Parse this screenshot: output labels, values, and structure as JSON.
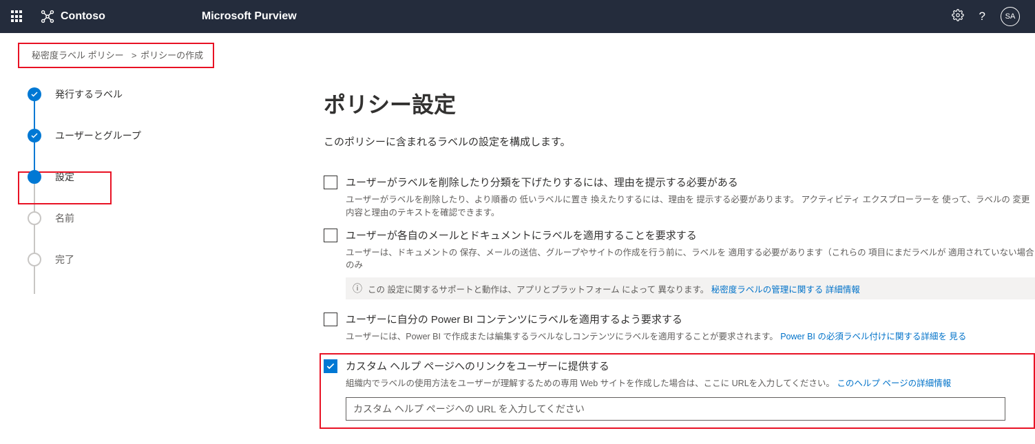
{
  "header": {
    "org": "Contoso",
    "product": "Microsoft Purview",
    "avatar": "SA"
  },
  "breadcrumb": {
    "parent": "秘密度ラベル ポリシー",
    "current": "ポリシーの作成"
  },
  "steps": [
    {
      "label": "発行するラベル"
    },
    {
      "label": "ユーザーとグループ"
    },
    {
      "label": "設定"
    },
    {
      "label": "名前"
    },
    {
      "label": "完了"
    }
  ],
  "main": {
    "title": "ポリシー設定",
    "description": "このポリシーに含まれるラベルの設定を構成します。"
  },
  "settings": {
    "opt1": {
      "title": "ユーザーがラベルを削除したり分類を下げたりするには、理由を提示する必要がある",
      "desc": "ユーザーがラベルを削除したり、より順番の 低いラベルに置き 換えたりするには、理由を 提示する必要があります。 アクティビティ エクスプローラーを 使って、ラベルの 変更内容と理由のテキストを確認できます。"
    },
    "opt2": {
      "title": "ユーザーが各自のメールとドキュメントにラベルを適用することを要求する",
      "desc": "ユーザーは、ドキュメントの 保存、メールの送信、グループやサイトの作成を行う前に、ラベルを 適用する必要があります（これらの 項目にまだラベルが 適用されていない場合のみ",
      "info_pre": "この 設定に関するサポートと動作は、アプリとプラットフォーム によって 異なります。",
      "info_link": "秘密度ラベルの管理に関する 詳細情報"
    },
    "opt3": {
      "title": "ユーザーに自分の Power BI コンテンツにラベルを適用するよう要求する",
      "desc_pre": "ユーザーには、Power BI で作成または編集するラベルなしコンテンツにラベルを適用することが要求されます。",
      "desc_link": "Power BI の必須ラベル付けに関する詳細を 見る"
    },
    "opt4": {
      "title": "カスタム ヘルプ ページへのリンクをユーザーに提供する",
      "desc_pre": "組織内でラベルの使用方法をユーザーが理解するための専用 Web サイトを作成した場合は、ここに  URLを入力してください。",
      "desc_link": "このヘルプ ページの詳細情報",
      "placeholder": "カスタム ヘルプ ページへの URL を入力してください"
    }
  }
}
